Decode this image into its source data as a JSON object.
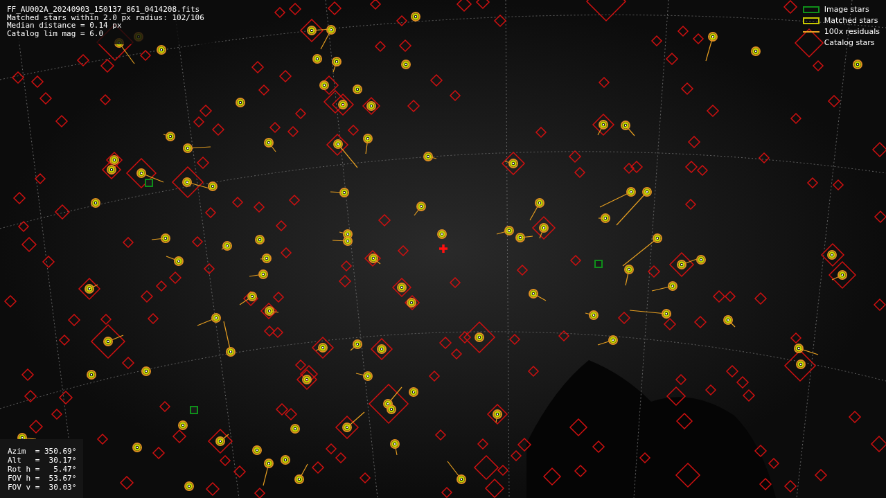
{
  "header_lines": [
    "FF_AU002A_20240903_150137_861_0414208.fits",
    "Matched stars within 2.0 px radius: 102/106",
    "Median distance = 0.14 px",
    "Catalog lim mag = 6.0"
  ],
  "legend": [
    {
      "kind": "image",
      "label": "Image stars"
    },
    {
      "kind": "matched",
      "label": "Matched stars"
    },
    {
      "kind": "residual",
      "label": "100x residuals"
    },
    {
      "kind": "catalog",
      "label": "Catalog stars"
    }
  ],
  "pointing_lines": [
    "Azim  = 350.69°",
    "Alt   =  30.17°",
    "Rot h =   5.47°",
    "FOV h =  53.67°",
    "FOV v =  30.03°"
  ]
}
